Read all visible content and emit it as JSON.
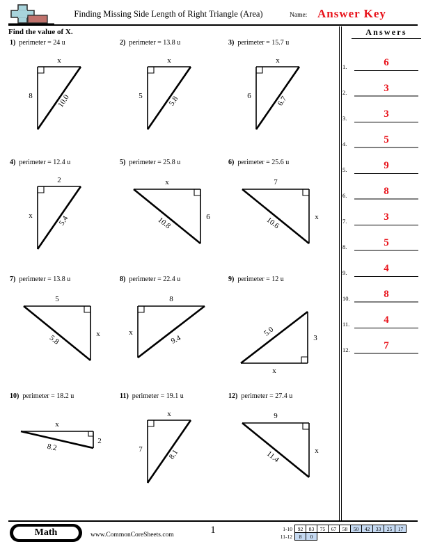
{
  "header": {
    "title": "Finding Missing Side Length of Right Triangle (Area)",
    "name_label": "Name:",
    "answer_key": "Answer Key",
    "instructions": "Find the value of X.",
    "answers_heading": "Answers"
  },
  "answers": [
    {
      "num": "1.",
      "value": "6"
    },
    {
      "num": "2.",
      "value": "3"
    },
    {
      "num": "3.",
      "value": "3"
    },
    {
      "num": "4.",
      "value": "5"
    },
    {
      "num": "5.",
      "value": "9"
    },
    {
      "num": "6.",
      "value": "8"
    },
    {
      "num": "7.",
      "value": "3"
    },
    {
      "num": "8.",
      "value": "5"
    },
    {
      "num": "9.",
      "value": "4"
    },
    {
      "num": "10.",
      "value": "8"
    },
    {
      "num": "11.",
      "value": "4"
    },
    {
      "num": "12.",
      "value": "7"
    }
  ],
  "problems": [
    {
      "num": "1)",
      "prompt": "perimeter = 24 u",
      "shape": "tall-left-right-angle-top-left",
      "top": "x",
      "side": "8",
      "hyp": "10.0"
    },
    {
      "num": "2)",
      "prompt": "perimeter = 13.8 u",
      "shape": "tall-left-right-angle-top-left",
      "top": "x",
      "side": "5",
      "hyp": "5.8"
    },
    {
      "num": "3)",
      "prompt": "perimeter = 15.7 u",
      "shape": "tall-left-right-angle-top-left",
      "top": "x",
      "side": "6",
      "hyp": "6.7"
    },
    {
      "num": "4)",
      "prompt": "perimeter = 12.4 u",
      "shape": "tall-left-right-angle-top-left",
      "top": "2",
      "side": "x",
      "hyp": "5.4"
    },
    {
      "num": "5)",
      "prompt": "perimeter = 25.8 u",
      "shape": "wide-right-angle-top-right",
      "top": "x",
      "side": "6",
      "hyp": "10.8"
    },
    {
      "num": "6)",
      "prompt": "perimeter = 25.6 u",
      "shape": "wide-right-angle-top-right",
      "top": "7",
      "side": "x",
      "hyp": "10.6"
    },
    {
      "num": "7)",
      "prompt": "perimeter = 13.8 u",
      "shape": "wide-right-angle-top-right",
      "top": "5",
      "side": "x",
      "hyp": "5.8"
    },
    {
      "num": "8)",
      "prompt": "perimeter = 22.4 u",
      "shape": "wide-right-angle-top-left",
      "top": "8",
      "side": "x",
      "hyp": "9.4"
    },
    {
      "num": "9)",
      "prompt": "perimeter = 12 u",
      "shape": "wide-right-angle-bottom-right",
      "top": "x",
      "side": "3",
      "hyp": "5.0"
    },
    {
      "num": "10)",
      "prompt": "perimeter = 18.2 u",
      "shape": "flat-right-angle-top-right",
      "top": "x",
      "side": "2",
      "hyp": "8.2"
    },
    {
      "num": "11)",
      "prompt": "perimeter = 19.1 u",
      "shape": "tall-left-right-angle-top-left",
      "top": "x",
      "side": "7",
      "hyp": "8.1"
    },
    {
      "num": "12)",
      "prompt": "perimeter = 27.4 u",
      "shape": "wide-right-angle-top-right",
      "top": "9",
      "side": "x",
      "hyp": "11.4"
    }
  ],
  "footer": {
    "subject": "Math",
    "website": "www.CommonCoreSheets.com",
    "page_number": "1",
    "grading": {
      "row1_label": "1-10",
      "row1": [
        "92",
        "83",
        "75",
        "67",
        "58",
        "50",
        "42",
        "33",
        "25",
        "17"
      ],
      "row1_highlight_from": 5,
      "row2_label": "11-12",
      "row2": [
        "8",
        "0"
      ],
      "row2_highlight_from": 0
    }
  },
  "colors": {
    "answer_red": "#e8131b",
    "grade_highlight": "#c5d9f1",
    "logo_blue": "#a8d4dc",
    "logo_red": "#c0726c",
    "gray_line": "#808080"
  }
}
